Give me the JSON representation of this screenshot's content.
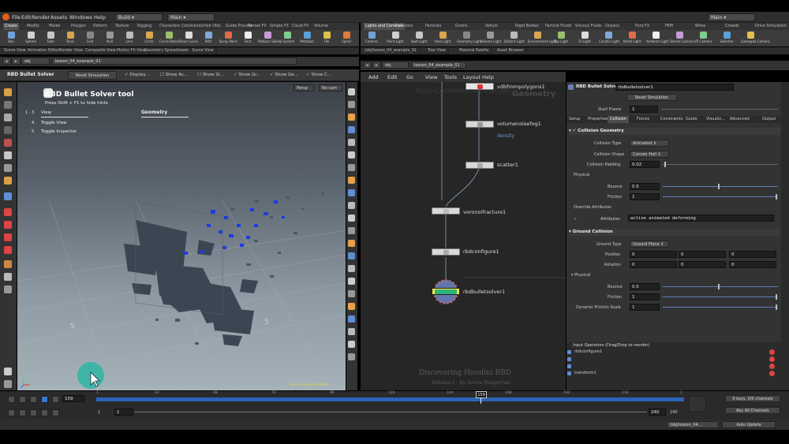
{
  "menu": {
    "items": [
      "File",
      "Edit",
      "Render",
      "Assets",
      "Windows",
      "Help"
    ],
    "build": "Build",
    "main_desk": "Main",
    "right_desk": "Main"
  },
  "shelf_tabs_left": [
    "Create",
    "Modify",
    "Model",
    "Polygon",
    "Deform",
    "Texture",
    "Rigging",
    "Characters",
    "Constraints",
    "Hair Utils",
    "Guide Process",
    "Terrain FX",
    "Simple FX",
    "Cloud FX",
    "Volume"
  ],
  "shelf_tools_left": [
    "Box",
    "Sphere",
    "Tube",
    "Torus",
    "Grid",
    "Null",
    "Line",
    "Circle",
    "Curve Bezier",
    "Draw Curve",
    "Path",
    "Spray Paint",
    "Font",
    "Platonic Solids",
    "L-System",
    "Metaball",
    "File",
    "Spiral"
  ],
  "shelf_tabs_right": [
    "Lights and Cameras",
    "Collisions",
    "Particles",
    "Grains",
    "Vellum",
    "Rigid Bodies",
    "Particle Fluids",
    "Viscous Fluids",
    "Oceans",
    "Pyro FX",
    "FEM",
    "Wires",
    "Crowds",
    "Drive Simulation"
  ],
  "shelf_tools_right": [
    "Camera",
    "Point Light",
    "Spot Light",
    "Area Light",
    "Geometry Light",
    "Volume Light",
    "Distant Light",
    "Environment Light",
    "Sky Light",
    "GI Light",
    "Caustic Light",
    "Portal Light",
    "Ambient Light",
    "Stereo Camera",
    "VR Camera",
    "Switcher",
    "Gamepad Camera"
  ],
  "pane_tabs_left": [
    "Scene View",
    "Animation Editor",
    "Render View",
    "Composite View",
    "Motion FX View",
    "Geometry Spreadsheet",
    "Scene View"
  ],
  "pane_tabs_right": [
    "/obj/lesson_04_example_01",
    "Tree View",
    "Material Palette",
    "Asset Browser"
  ],
  "left_path": {
    "obj": "obj",
    "file": "lesson_04_example_01"
  },
  "right_path": {
    "obj": "obj",
    "file": "lesson_04_example_01"
  },
  "viewer_toolbar": {
    "tool": "RBD Bullet Solver",
    "reset": "Reset Simulation",
    "display": "Display...",
    "show_ac": "Show Ac...",
    "show_sl": "Show Sl...",
    "show_gr": "Show Gr...",
    "show_ge": "Show Ge...",
    "show_c": "Show C..."
  },
  "hud": {
    "title": "RBD Bullet Solver tool",
    "hint": "Press Shift + F1 to hide hints",
    "row1_keys": "1 - 3",
    "row1_label": "View",
    "row2_key": "4",
    "row2_label": "Toggle View",
    "row3_key": "5",
    "row3_label": "Toggle Inspector",
    "context": "Geometry"
  },
  "viewport": {
    "persp": "Persp",
    "cam": "No cam",
    "watermark": "Non-Commercial Edition",
    "grid_labels": [
      "5",
      "5"
    ]
  },
  "network_menu": [
    "Add",
    "Edit",
    "Go",
    "View",
    "Tools",
    "Layout",
    "Help"
  ],
  "network": {
    "watermark": "Non-Commercial Edition",
    "context": "Geometry",
    "nodes": [
      {
        "name": "vdbfrompolygons1",
        "sub": ""
      },
      {
        "name": "volumenoisefog1",
        "sub": "density"
      },
      {
        "name": "scatter1",
        "sub": ""
      },
      {
        "name": "voronoifracture1",
        "sub": ""
      },
      {
        "name": "rbdconfigure1",
        "sub": ""
      },
      {
        "name": "rbdbulletsolver1",
        "sub": ""
      }
    ],
    "caption_title": "Discovering Houdini RBD",
    "caption_sub": "Volume I - by Arsen Magaryan"
  },
  "params": {
    "node_type": "RBD Bullet Solver",
    "node_name": "rbdbulletsolver1",
    "reset": "Reset Simulation",
    "start_frame_label": "Start Frame",
    "start_frame": "1",
    "tabs": [
      "Setup",
      "Properties",
      "Collision",
      "Forces",
      "Constraints",
      "Guide",
      "Visualiz...",
      "Advanced",
      "Output"
    ],
    "collision_geometry": "Collision Geometry",
    "collision_type_label": "Collision Type",
    "collision_type": "Animated",
    "collision_shape_label": "Collision Shape",
    "collision_shape": "Convex Hull",
    "collision_padding_label": "Collision Padding",
    "collision_padding": "0.02",
    "physical_label": "Physical",
    "bounce_label": "Bounce",
    "bounce": "0.5",
    "friction_label": "Friction",
    "friction": "1",
    "override_label": "Override Attributes",
    "attributes_label": "Attributes",
    "attributes": "active animated deforming",
    "ground_collision": "Ground Collision",
    "ground_type_label": "Ground Type",
    "ground_type": "Ground Plane",
    "position_label": "Position",
    "position": [
      "0",
      "0",
      "0"
    ],
    "rotation_label": "Rotation",
    "rotation": [
      "0",
      "0",
      "0"
    ],
    "physical2_label": "Physical",
    "bounce2_label": "Bounce",
    "bounce2": "0.5",
    "friction2_label": "Friction",
    "friction2": "1",
    "dyn_friction_label": "Dynamic Friction Scale",
    "dyn_friction": "1",
    "inputs_header": "Input Operators (Drag/Drop to reorder)",
    "inputs": [
      "rbdconfigure1",
      "",
      "",
      "transform1"
    ]
  },
  "timeline": {
    "current": "159",
    "marker": "159",
    "ticks": [
      "1",
      "24",
      "48",
      "72",
      "96",
      "120",
      "144",
      "168",
      "192",
      "216",
      "2"
    ],
    "start": "1",
    "range_start": "1",
    "range_end": "240",
    "end": "240",
    "keys": "0 keys, 0/0 channels",
    "key_all": "Key All Channels"
  },
  "status": {
    "path": "/obj/lesson_04...",
    "update": "Auto Update"
  },
  "colors": {
    "accent": "#3a78c9",
    "teal": "#2fb5a5",
    "node_sel": "#f5e642"
  }
}
